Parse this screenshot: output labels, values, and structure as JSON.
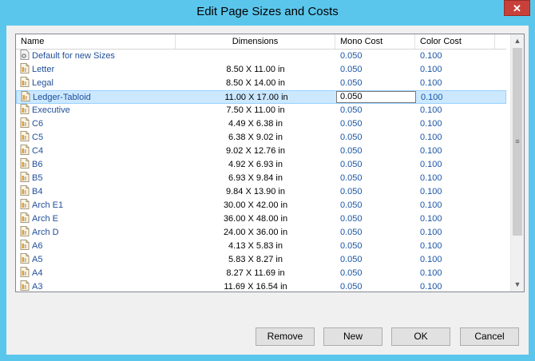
{
  "window": {
    "title": "Edit Page Sizes and Costs",
    "close_glyph": "✕"
  },
  "columns": {
    "name": "Name",
    "dimensions": "Dimensions",
    "mono": "Mono Cost",
    "color": "Color Cost"
  },
  "rows": [
    {
      "name": "Default for new Sizes",
      "dim": "",
      "mono": "0.050",
      "color": "0.100",
      "icon": "gear-page-icon"
    },
    {
      "name": "Letter",
      "dim": "8.50 X 11.00 in",
      "mono": "0.050",
      "color": "0.100",
      "icon": "page-icon"
    },
    {
      "name": "Legal",
      "dim": "8.50 X 14.00 in",
      "mono": "0.050",
      "color": "0.100",
      "icon": "page-icon"
    },
    {
      "name": "Ledger-Tabloid",
      "dim": "11.00 X 17.00 in",
      "mono": "0.050",
      "color": "0.100",
      "icon": "page-icon",
      "selected": true
    },
    {
      "name": "Executive",
      "dim": "7.50 X 11.00 in",
      "mono": "0.050",
      "color": "0.100",
      "icon": "page-icon"
    },
    {
      "name": "C6",
      "dim": "4.49 X 6.38 in",
      "mono": "0.050",
      "color": "0.100",
      "icon": "page-icon"
    },
    {
      "name": "C5",
      "dim": "6.38 X 9.02 in",
      "mono": "0.050",
      "color": "0.100",
      "icon": "page-icon"
    },
    {
      "name": "C4",
      "dim": "9.02 X 12.76 in",
      "mono": "0.050",
      "color": "0.100",
      "icon": "page-icon"
    },
    {
      "name": "B6",
      "dim": "4.92 X 6.93 in",
      "mono": "0.050",
      "color": "0.100",
      "icon": "page-icon"
    },
    {
      "name": "B5",
      "dim": "6.93 X 9.84 in",
      "mono": "0.050",
      "color": "0.100",
      "icon": "page-icon"
    },
    {
      "name": "B4",
      "dim": "9.84 X 13.90 in",
      "mono": "0.050",
      "color": "0.100",
      "icon": "page-icon"
    },
    {
      "name": "Arch E1",
      "dim": "30.00 X 42.00 in",
      "mono": "0.050",
      "color": "0.100",
      "icon": "page-icon"
    },
    {
      "name": "Arch E",
      "dim": "36.00 X 48.00 in",
      "mono": "0.050",
      "color": "0.100",
      "icon": "page-icon"
    },
    {
      "name": "Arch D",
      "dim": "24.00 X 36.00 in",
      "mono": "0.050",
      "color": "0.100",
      "icon": "page-icon"
    },
    {
      "name": "A6",
      "dim": "4.13 X 5.83 in",
      "mono": "0.050",
      "color": "0.100",
      "icon": "page-icon"
    },
    {
      "name": "A5",
      "dim": "5.83 X 8.27 in",
      "mono": "0.050",
      "color": "0.100",
      "icon": "page-icon"
    },
    {
      "name": "A4",
      "dim": "8.27 X 11.69 in",
      "mono": "0.050",
      "color": "0.100",
      "icon": "page-icon"
    },
    {
      "name": "A3",
      "dim": "11.69 X 16.54 in",
      "mono": "0.050",
      "color": "0.100",
      "icon": "page-icon"
    }
  ],
  "editing": {
    "row_index": 3,
    "value": "0.050"
  },
  "scrollbar": {
    "up_glyph": "▲",
    "down_glyph": "▼",
    "grip_glyph": "≡"
  },
  "buttons": {
    "remove": "Remove",
    "new": "New",
    "ok": "OK",
    "cancel": "Cancel"
  },
  "colors": {
    "title_bar": "#5bc6ec",
    "close": "#c7413a",
    "selection": "#cce8ff",
    "link_text": "#1f4e9a"
  }
}
